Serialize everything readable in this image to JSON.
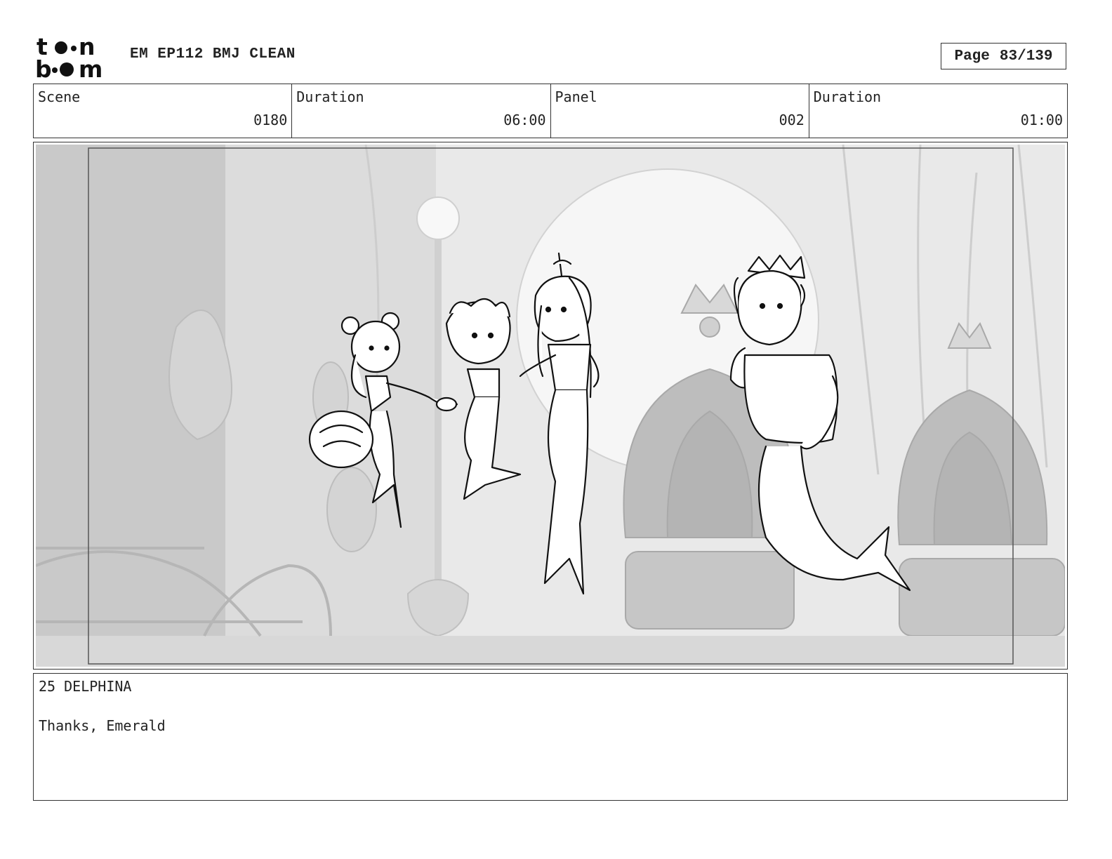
{
  "header": {
    "logo_text": "toon boom",
    "title": "EM EP112 BMJ CLEAN",
    "page_label": "Page",
    "page_value": "83/139"
  },
  "info": {
    "scene_label": "Scene",
    "scene_value": "0180",
    "scene_duration_label": "Duration",
    "scene_duration_value": "06:00",
    "panel_label": "Panel",
    "panel_value": "002",
    "panel_duration_label": "Duration",
    "panel_duration_value": "01:00"
  },
  "dialogue": {
    "line1": "25 DELPHINA",
    "line2": "Thanks, Emerald"
  }
}
